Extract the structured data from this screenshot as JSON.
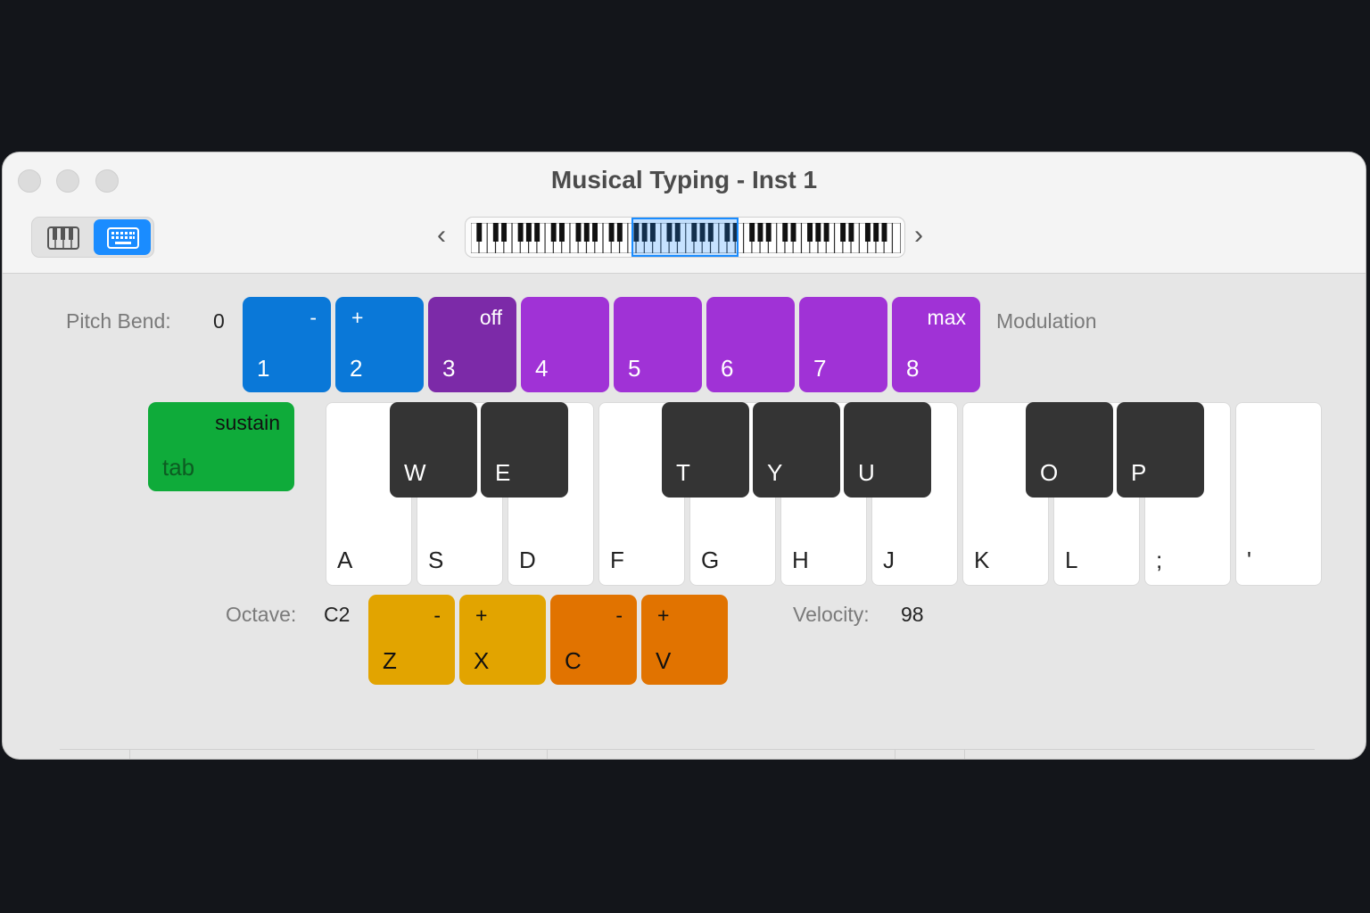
{
  "window": {
    "title": "Musical Typing - Inst 1"
  },
  "toolbar": {
    "piano_view_icon": "piano-icon",
    "keyboard_view_icon": "keyboard-icon",
    "prev_label": "‹",
    "next_label": "›"
  },
  "pitch_bend": {
    "label": "Pitch Bend:",
    "value": "0"
  },
  "modulation": {
    "label": "Modulation"
  },
  "top_keys": [
    {
      "top": "-",
      "key": "1",
      "color": "#0a78d8"
    },
    {
      "top": "+",
      "key": "2",
      "color": "#0a78d8"
    },
    {
      "top": "off",
      "key": "3",
      "color": "#7c2aa8"
    },
    {
      "top": "",
      "key": "4",
      "color": "#a032d6"
    },
    {
      "top": "",
      "key": "5",
      "color": "#a032d6"
    },
    {
      "top": "",
      "key": "6",
      "color": "#a032d6"
    },
    {
      "top": "",
      "key": "7",
      "color": "#a032d6"
    },
    {
      "top": "max",
      "key": "8",
      "color": "#a032d6"
    }
  ],
  "sustain": {
    "top": "sustain",
    "key": "tab",
    "color": "#0fab3a"
  },
  "white_keys": [
    "A",
    "S",
    "D",
    "F",
    "G",
    "H",
    "J",
    "K",
    "L",
    ";",
    "'"
  ],
  "black_keys": [
    "W",
    "E",
    "T",
    "Y",
    "U",
    "O",
    "P"
  ],
  "octave": {
    "label": "Octave:",
    "value": "C2"
  },
  "velocity": {
    "label": "Velocity:",
    "value": "98"
  },
  "bottom_keys": [
    {
      "top": "-",
      "key": "Z",
      "color": "#e2a400"
    },
    {
      "top": "+",
      "key": "X",
      "color": "#e2a400"
    },
    {
      "top": "-",
      "key": "C",
      "color": "#e17300"
    },
    {
      "top": "+",
      "key": "V",
      "color": "#e17300"
    }
  ]
}
